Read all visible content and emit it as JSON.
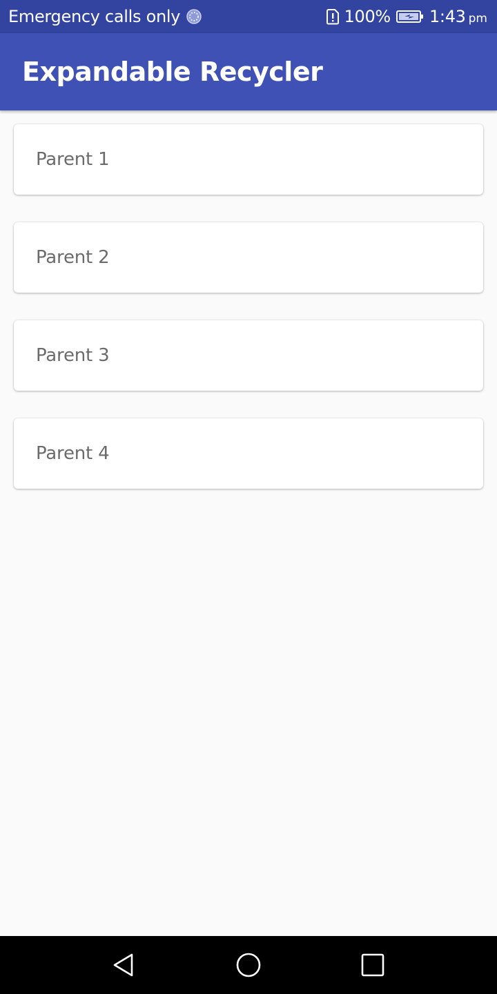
{
  "status_bar": {
    "carrier_text": "Emergency calls only",
    "battery_percent": "100%",
    "time": "1:43",
    "ampm": "pm",
    "icons": [
      "sync-icon",
      "sim-alert-icon",
      "battery-charging-icon"
    ]
  },
  "app_bar": {
    "title": "Expandable Recycler",
    "color": "#3f51b5"
  },
  "list": {
    "items": [
      {
        "label": "Parent 1"
      },
      {
        "label": "Parent 2"
      },
      {
        "label": "Parent 3"
      },
      {
        "label": "Parent 4"
      }
    ]
  },
  "nav_bar": {
    "icons": [
      "back-icon",
      "home-icon",
      "recents-icon"
    ]
  },
  "colors": {
    "status_bar": "#3243a0",
    "background": "#fafafa",
    "card_text": "#6b6b6b"
  }
}
